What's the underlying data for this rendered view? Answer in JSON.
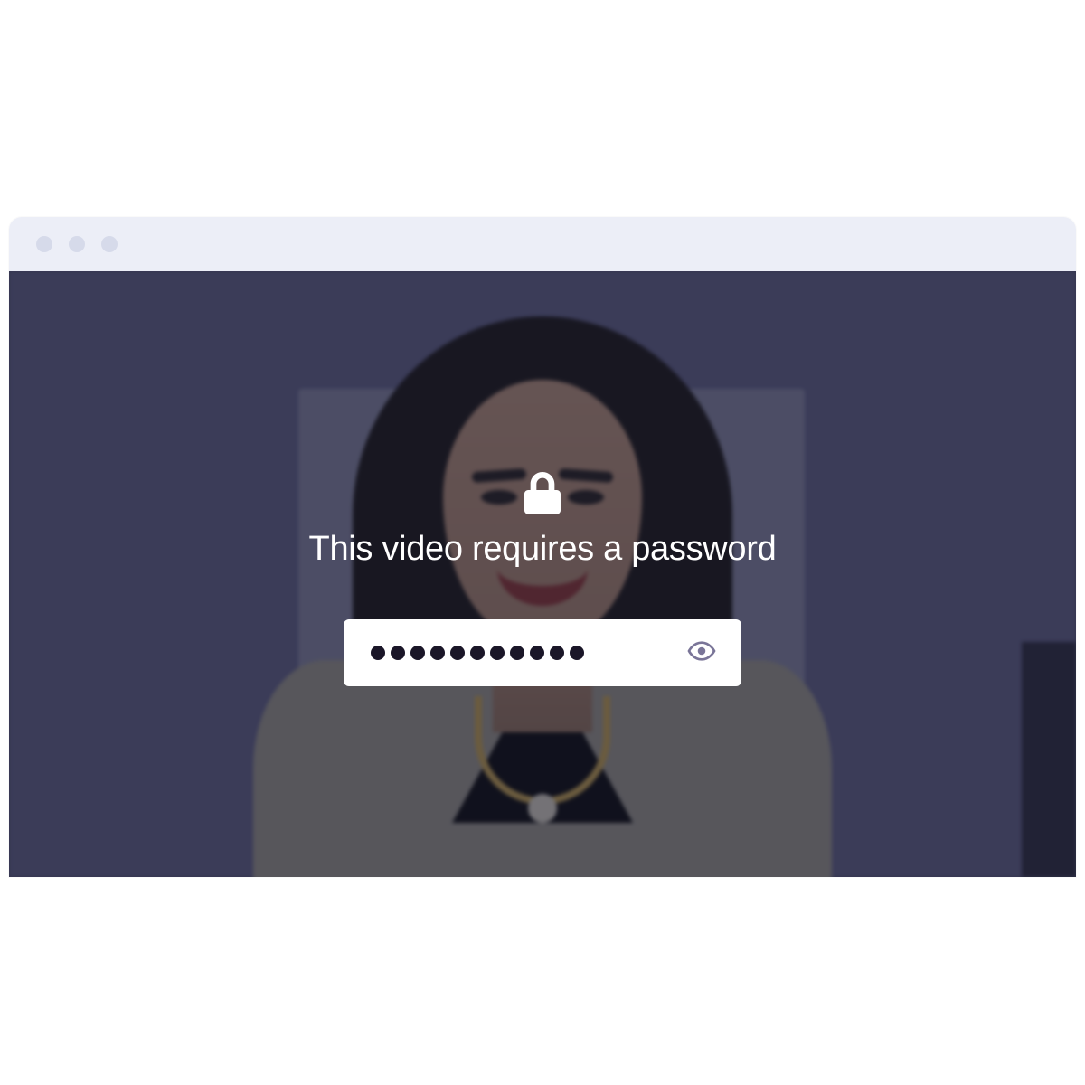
{
  "gate": {
    "heading": "This video requires a password",
    "password_value": "●●●●●●●●●●●",
    "password_length": 11,
    "colors": {
      "titlebar": "#eceef7",
      "card_bg": "#ffffff",
      "text": "#ffffff",
      "dot": "#1a1628",
      "eye_icon": "#7a7598"
    },
    "icons": {
      "lock": "lock-icon",
      "eye": "eye-icon"
    }
  }
}
